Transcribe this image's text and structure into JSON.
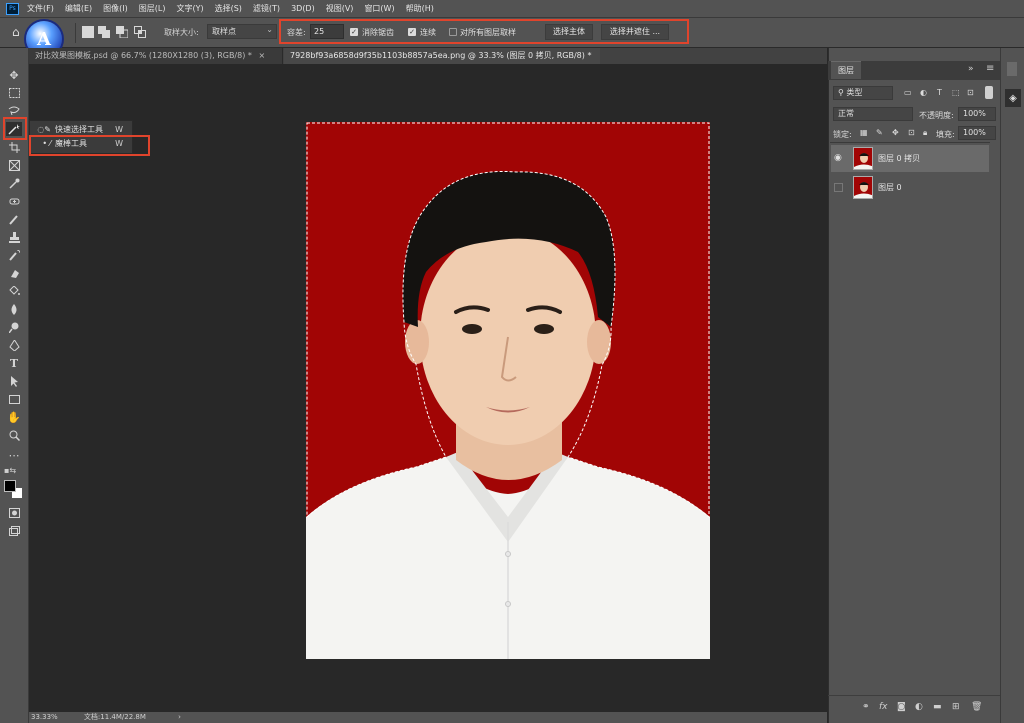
{
  "app": {
    "logo_text": "Ps"
  },
  "brand_badge": "A",
  "menu": [
    "文件(F)",
    "编辑(E)",
    "图像(I)",
    "图层(L)",
    "文字(Y)",
    "选择(S)",
    "滤镜(T)",
    "3D(D)",
    "视图(V)",
    "窗口(W)",
    "帮助(H)"
  ],
  "options": {
    "sample_size_label": "取样大小:",
    "sample_size_value": "取样点",
    "tolerance_label": "容差:",
    "tolerance_value": "25",
    "antialias_label": "消除锯齿",
    "contiguous_label": "连续",
    "sample_all_label": "对所有图层取样",
    "select_subject": "选择主体",
    "select_mask": "选择并遮住 ..."
  },
  "tabs": [
    {
      "label": "对比效果图模板.psd @ 66.7% (1280X1280 (3), RGB/8) *",
      "close": "×"
    },
    {
      "label": "7928bf93a6858d9f35b1103b8857a5ea.png @ 33.3% (图层 0 拷贝, RGB/8) *",
      "close": "×"
    }
  ],
  "flyout": [
    {
      "label": "快速选择工具",
      "key": "W",
      "icon": "quick-selection-icon"
    },
    {
      "label": "魔棒工具",
      "key": "W",
      "icon": "magic-wand-icon"
    }
  ],
  "status": {
    "zoom": "33.33%",
    "doc": "文档:11.4M/22.8M",
    "arrow": "›"
  },
  "layers_panel": {
    "tab_label": "图层",
    "filter_label": "类型",
    "blend_mode": "正常",
    "opacity_label": "不透明度:",
    "opacity_value": "100%",
    "lock_label": "锁定:",
    "fill_label": "填充:",
    "fill_value": "100%",
    "layers": [
      {
        "name": "图层 0 拷贝",
        "visible": true,
        "selected": true
      },
      {
        "name": "图层 0",
        "visible": false,
        "selected": false
      }
    ]
  },
  "colors": {
    "accent_highlight": "#e0442c",
    "background_red": "#a10505",
    "ui_gray": "#535353"
  }
}
